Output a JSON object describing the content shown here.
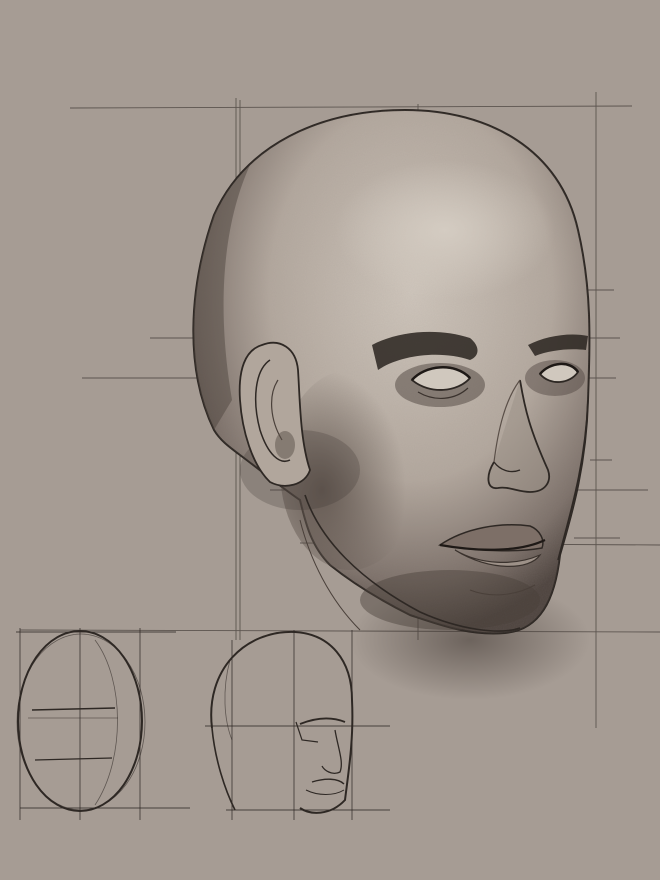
{
  "canvas": {
    "background": "#a69c94",
    "line_color": "#2e2824",
    "guide_color": "#4a433e",
    "skin_light": "#c9c0b6",
    "skin_shadow": "#5a4f48"
  },
  "artwork": {
    "subject": "head-portrait-sketch",
    "construction_studies": [
      "egg-front-study",
      "head-three-quarter-study"
    ]
  }
}
